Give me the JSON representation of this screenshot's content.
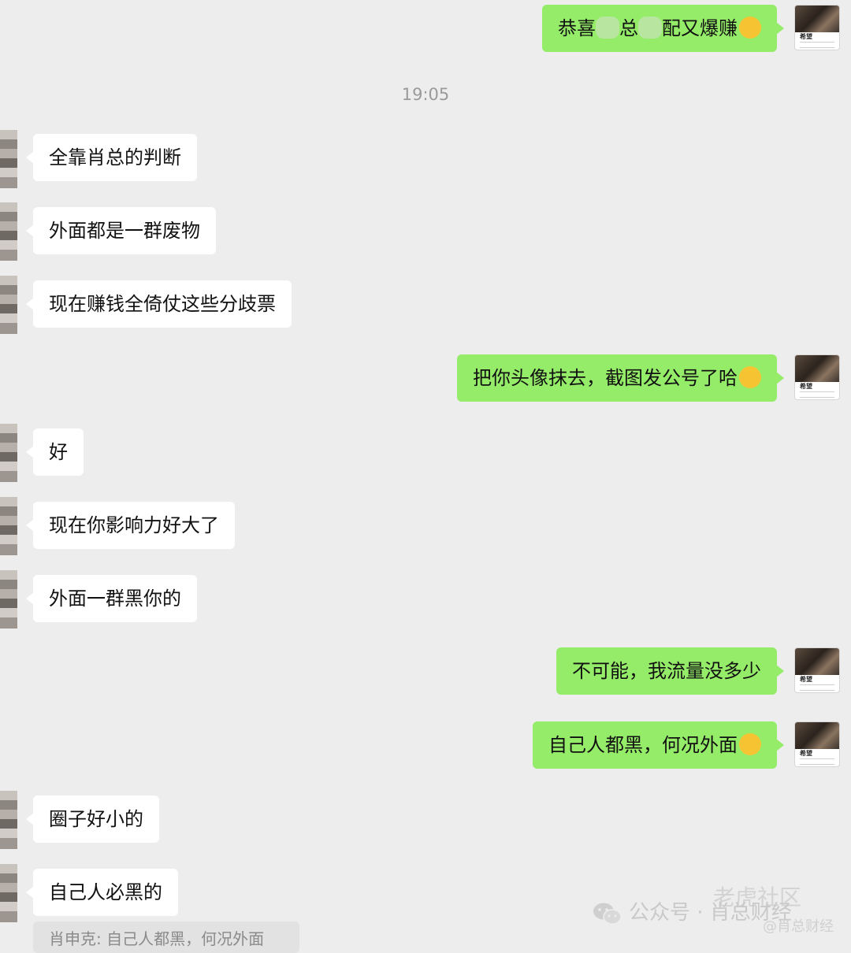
{
  "timestamp": "19:05",
  "messages": {
    "m1": {
      "part1": "恭喜",
      "part2": "总",
      "part3": "配又爆赚",
      "emoji": "thinking-face-emoji"
    },
    "m2": {
      "text": "全靠肖总的判断"
    },
    "m3": {
      "text": "外面都是一群废物"
    },
    "m4": {
      "text": "现在赚钱全倚仗这些分歧票"
    },
    "m5": {
      "text": "把你头像抹去，截图发公号了哈",
      "emoji": "thinking-face-emoji"
    },
    "m6": {
      "text": "好"
    },
    "m7": {
      "text": "现在你影响力好大了"
    },
    "m8": {
      "text": "外面一群黑你的"
    },
    "m9": {
      "text": "不可能，我流量没多少"
    },
    "m10": {
      "text": "自己人都黑，何况外面",
      "emoji": "tears-of-joy-emoji"
    },
    "m11": {
      "text": "圈子好小的"
    },
    "m12": {
      "text": "自己人必黑的"
    }
  },
  "quote": {
    "text": "肖申克: 自己人都黑，何况外面"
  },
  "self_avatar": {
    "label": "希望"
  },
  "watermarks": {
    "main": "公众号 · 肖总财经",
    "secondary": "老虎社区",
    "handle": "@肖总财经"
  },
  "colors": {
    "background": "#ededed",
    "incoming_bubble": "#ffffff",
    "outgoing_bubble": "#95ec69",
    "timestamp": "#9a9a9a"
  }
}
